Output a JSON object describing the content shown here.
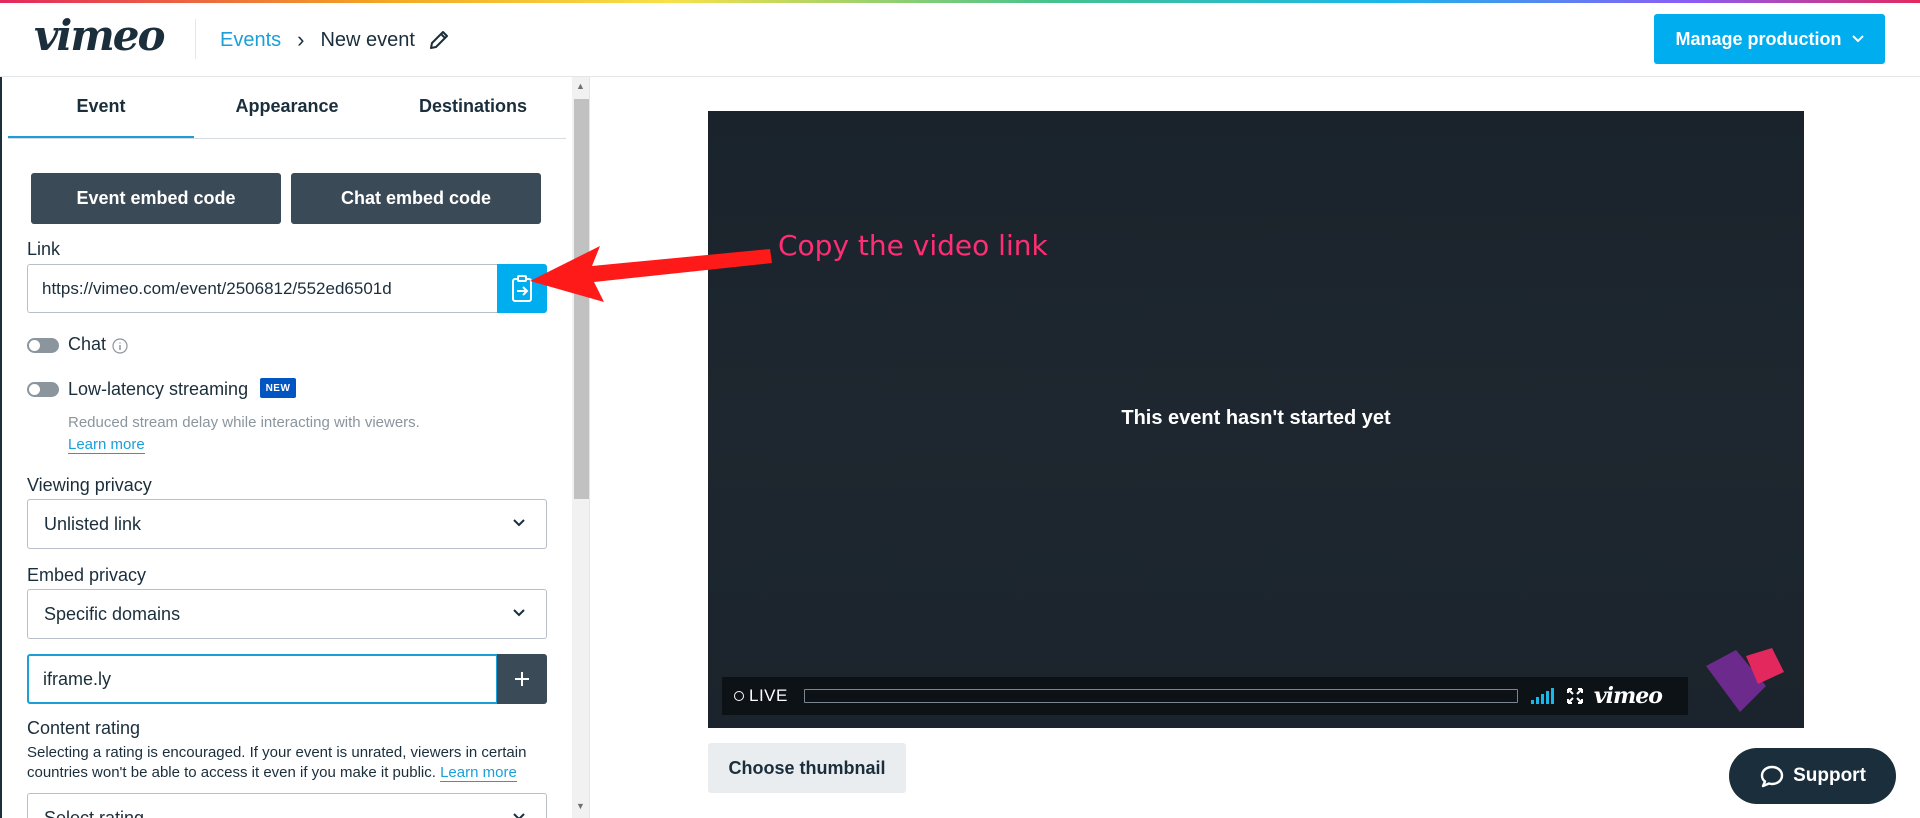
{
  "header": {
    "logo": "vimeo",
    "breadcrumb": {
      "parent": "Events",
      "separator": "›",
      "current": "New event"
    },
    "manage_button": "Manage production"
  },
  "tabs": [
    {
      "label": "Event",
      "active": true
    },
    {
      "label": "Appearance",
      "active": false
    },
    {
      "label": "Destinations",
      "active": false
    }
  ],
  "embed": {
    "event_embed_label": "Event embed code",
    "chat_embed_label": "Chat embed code"
  },
  "link": {
    "label": "Link",
    "value": "https://vimeo.com/event/2506812/552ed6501d"
  },
  "chat": {
    "label": "Chat",
    "enabled": false
  },
  "low_latency": {
    "label": "Low-latency streaming",
    "badge": "NEW",
    "enabled": false,
    "helper": "Reduced stream delay while interacting with viewers.",
    "learn_more": "Learn more"
  },
  "viewing_privacy": {
    "label": "Viewing privacy",
    "value": "Unlisted link"
  },
  "embed_privacy": {
    "label": "Embed privacy",
    "value": "Specific domains"
  },
  "domain": {
    "value": "iframe.ly"
  },
  "content_rating": {
    "label": "Content rating",
    "description": "Selecting a rating is encouraged. If your event is unrated, viewers in certain countries won't be able to access it even if you make it public.",
    "learn_more": "Learn more",
    "select_placeholder": "Select rating"
  },
  "player": {
    "message": "This event hasn't started yet",
    "live_label": "LIVE",
    "logo": "vimeo"
  },
  "annotation": {
    "text": "Copy the video link",
    "color": "#ff2d73"
  },
  "thumbnail_button": "Choose thumbnail",
  "support_button": "Support",
  "colors": {
    "accent": "#00adef",
    "dark_button": "#3b4a57",
    "link": "#1a9fd9"
  }
}
